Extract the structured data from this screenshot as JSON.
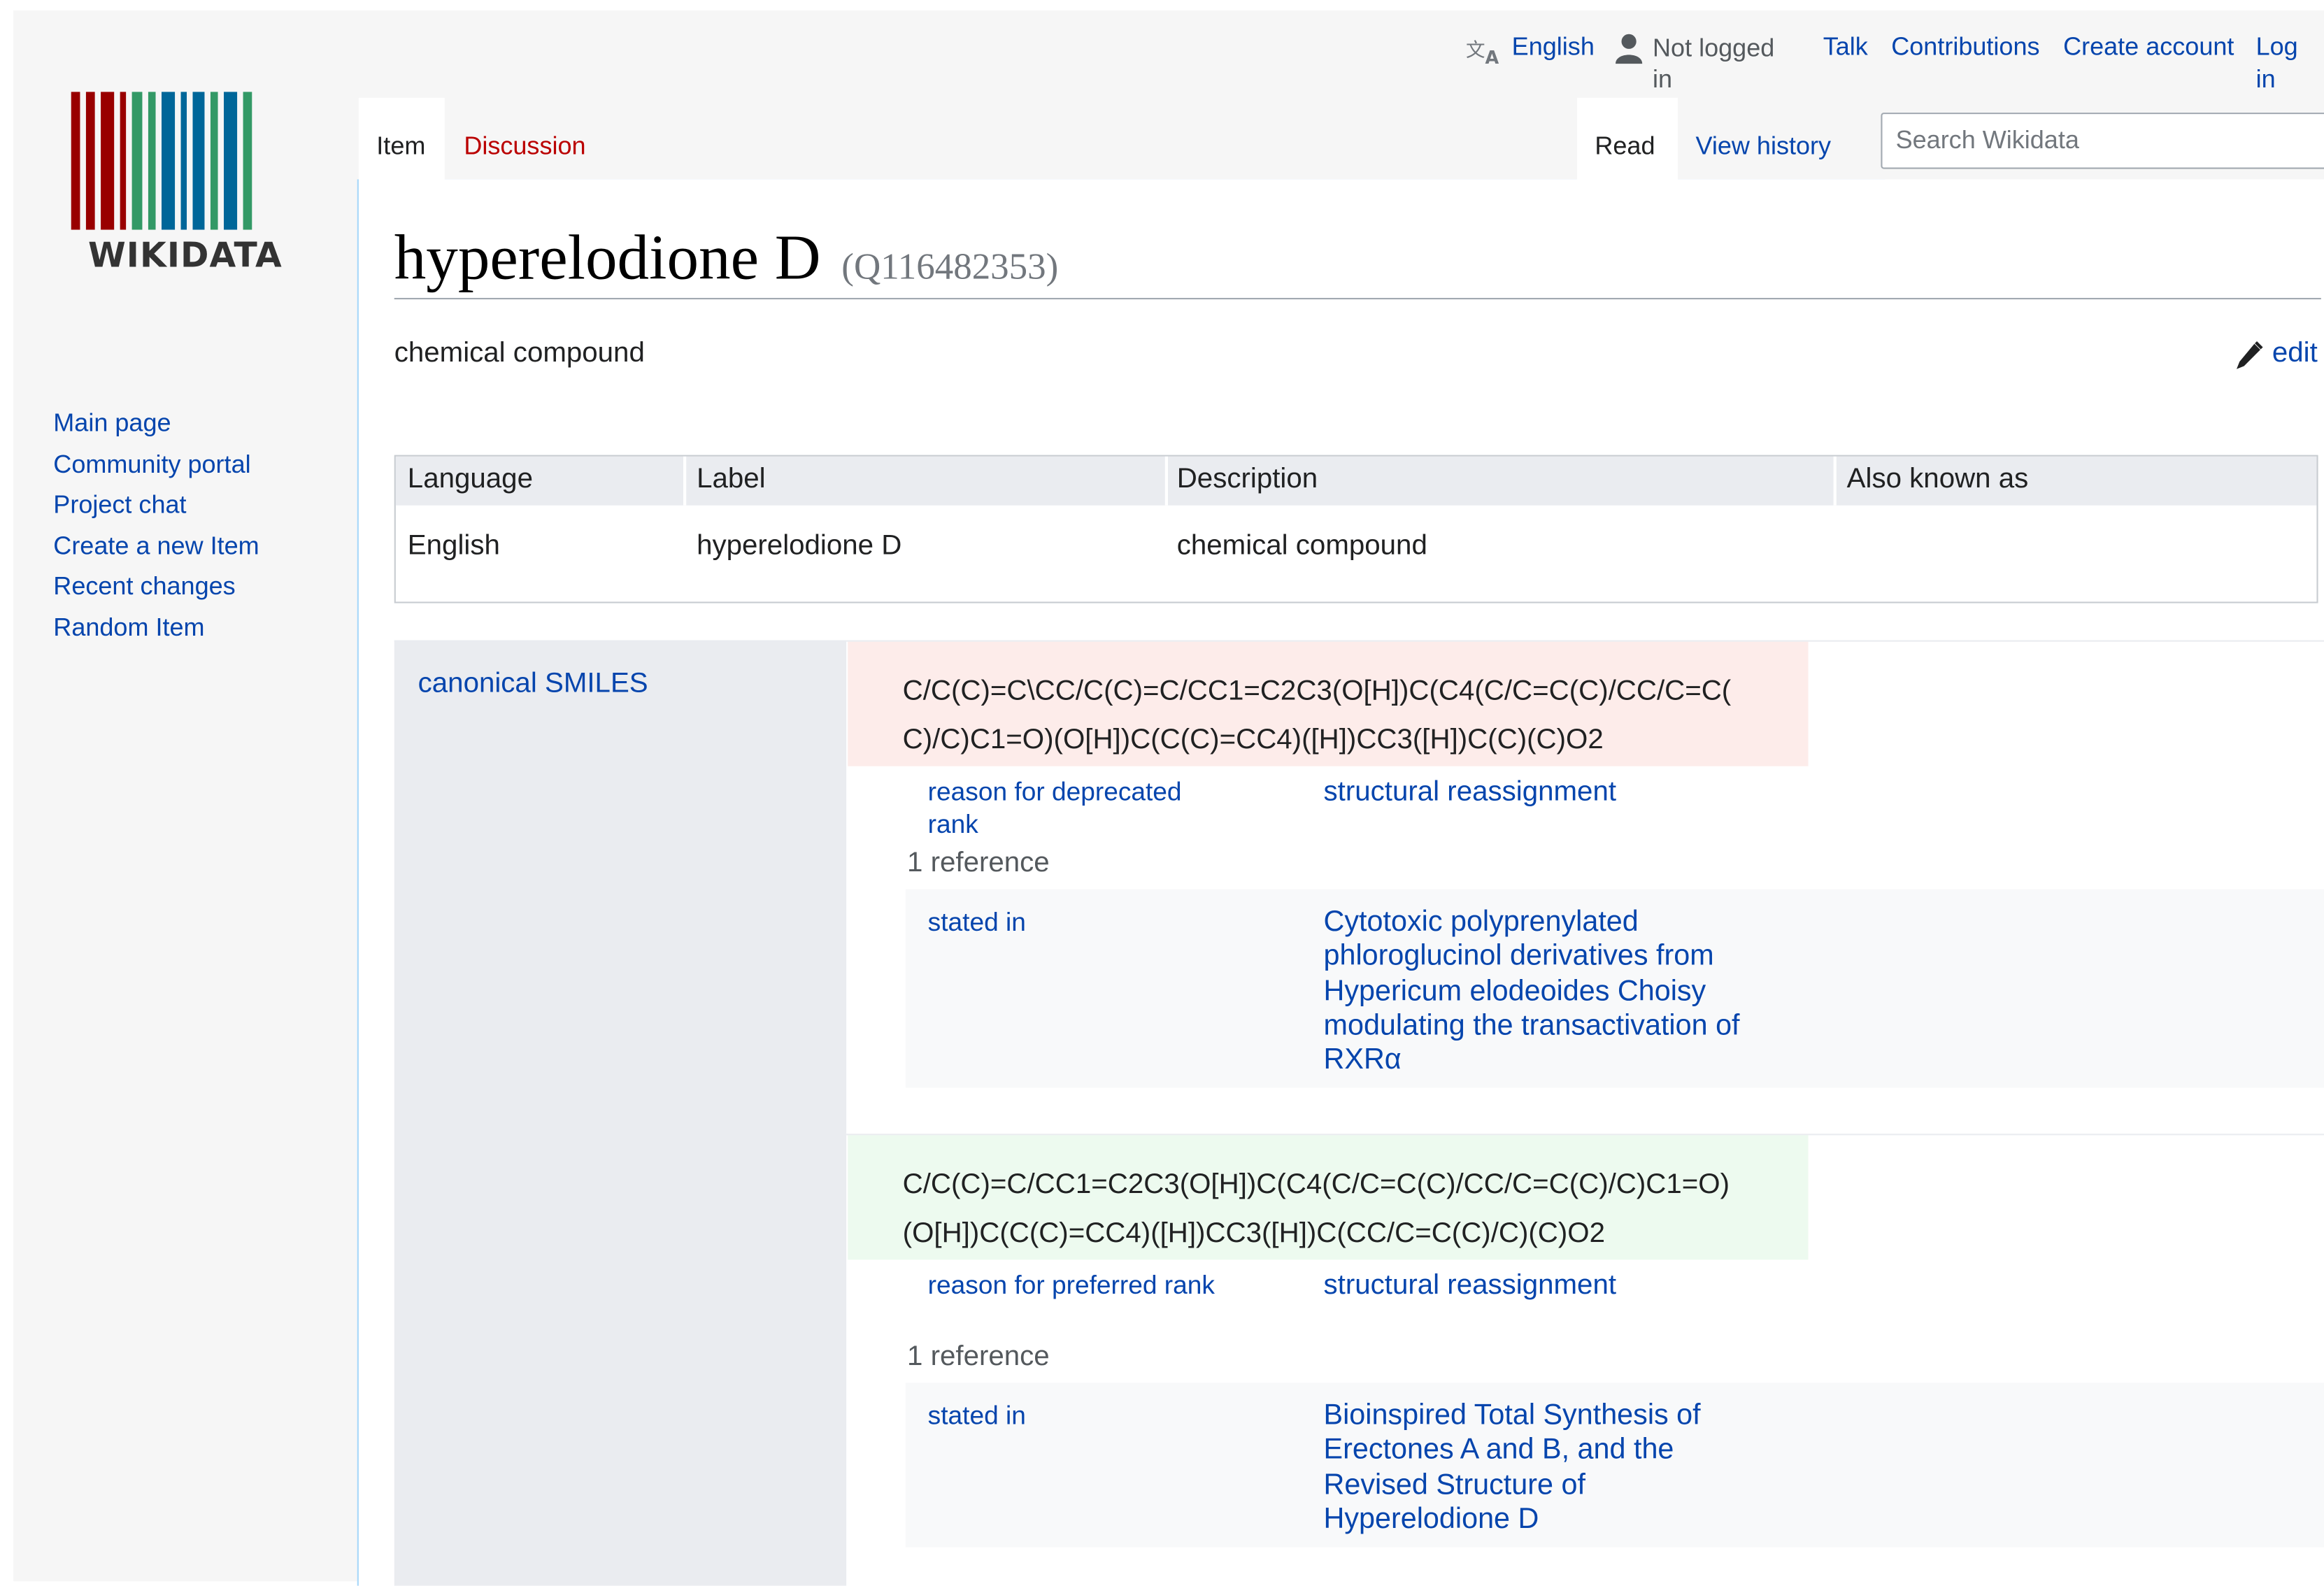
{
  "logo": {
    "wordmark": "WIKIDATA",
    "bar_colors": [
      "#990000",
      "#990000",
      "#990000",
      "#990000",
      "#339966",
      "#339966",
      "#006699",
      "#006699",
      "#006699",
      "#339966",
      "#006699",
      "#339966"
    ]
  },
  "sidebar": {
    "items": [
      {
        "label": "Main page"
      },
      {
        "label": "Community portal"
      },
      {
        "label": "Project chat"
      },
      {
        "label": "Create a new Item"
      },
      {
        "label": "Recent changes"
      },
      {
        "label": "Random Item"
      }
    ]
  },
  "personal_tools": {
    "language": "English",
    "not_logged_in_1": "Not logged",
    "not_logged_in_2": "in",
    "talk": "Talk",
    "contributions": "Contributions",
    "create_account": "Create account",
    "log_in_1": "Log",
    "log_in_2": "in"
  },
  "tabs": {
    "item": "Item",
    "discussion": "Discussion",
    "read": "Read",
    "view_history": "View history"
  },
  "search": {
    "placeholder": "Search Wikidata"
  },
  "page": {
    "title": "hyperelodione D",
    "qid": "(Q116482353)",
    "description": "chemical compound",
    "edit_label": "edit"
  },
  "terms": {
    "headers": [
      "Language",
      "Label",
      "Description",
      "Also known as"
    ],
    "row": [
      "English",
      "hyperelodione D",
      "chemical compound",
      ""
    ]
  },
  "statement": {
    "property": "canonical SMILES",
    "values": [
      {
        "rank": "deprecated",
        "value_line1": "C/C(C)=C\\CC/C(C)=C/CC1=C2C3(O[H])C(C4(C/C=C(C)/CC/C=C(",
        "value_line2": "C)/C)C1=O)(O[H])C(C(C)=CC4)([H])CC3([H])C(C)(C)O2",
        "qualifier_property_1": "reason for deprecated",
        "qualifier_property_2": "rank",
        "qualifier_value": "structural reassignment",
        "reference_count": "1 reference",
        "ref_property": "stated in",
        "ref_value_lines": [
          "Cytotoxic polyprenylated",
          "phloroglucinol derivatives from",
          "Hypericum elodeoides Choisy",
          "modulating the transactivation of",
          "RXRα"
        ]
      },
      {
        "rank": "preferred",
        "value_line1": "C/C(C)=C/CC1=C2C3(O[H])C(C4(C/C=C(C)/CC/C=C(C)/C)C1=O)",
        "value_line2": "(O[H])C(C(C)=CC4)([H])CC3([H])C(CC/C=C(C)/C)(C)O2",
        "qualifier_property_1": "reason for preferred rank",
        "qualifier_value": "structural reassignment",
        "reference_count": "1 reference",
        "ref_property": "stated in",
        "ref_value_lines": [
          "Bioinspired Total Synthesis of",
          "Erectones A and B, and the",
          "Revised Structure of",
          "Hyperelodione D"
        ]
      }
    ]
  }
}
